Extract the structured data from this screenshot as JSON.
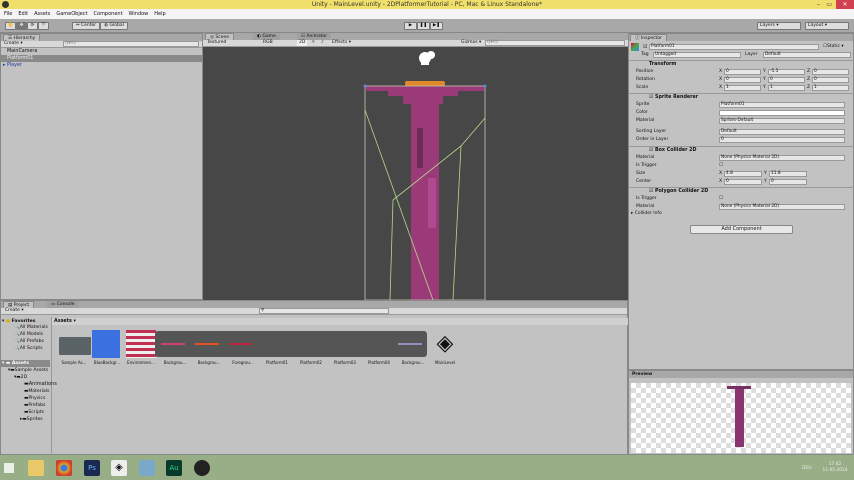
{
  "window": {
    "title": "Unity - MainLevel.unity - 2DPlatformerTutorial - PC, Mac & Linux Standalone*"
  },
  "menu": [
    "File",
    "Edit",
    "Assets",
    "GameObject",
    "Component",
    "Window",
    "Help"
  ],
  "toolbar": {
    "center": "Center",
    "global": "Global",
    "layers": "Layers",
    "layout": "Layout"
  },
  "hierarchy": {
    "tab": "Hierarchy",
    "create": "Create",
    "search": "Q▾All",
    "items": [
      "MainCamera",
      "Platform01",
      "Player"
    ]
  },
  "scene": {
    "tabs": [
      "Scene",
      "Game",
      "Animator"
    ],
    "render_mode": "Textured",
    "color_mode": "RGB",
    "mode_2d": "2D",
    "effects": "Effects",
    "gizmos": "Gizmos",
    "search": "Q▾All"
  },
  "inspector": {
    "tab": "Inspector",
    "object_name": "Platform01",
    "static": "Static",
    "tag_label": "Tag",
    "tag": "Untagged",
    "layer_label": "Layer",
    "layer": "Default",
    "transform": {
      "title": "Transform",
      "rows": [
        {
          "label": "Position",
          "x": "0",
          "y": "-5.5",
          "z": "0"
        },
        {
          "label": "Rotation",
          "x": "0",
          "y": "0",
          "z": "0"
        },
        {
          "label": "Scale",
          "x": "1",
          "y": "1",
          "z": "1"
        }
      ]
    },
    "sprite_renderer": {
      "title": "Sprite Renderer",
      "sprite_label": "Sprite",
      "sprite": "Platform01",
      "color_label": "Color",
      "material_label": "Material",
      "material": "Sprites-Default",
      "sorting_layer_label": "Sorting Layer",
      "sorting_layer": "Default",
      "order_label": "Order in Layer",
      "order": "0"
    },
    "box_collider": {
      "title": "Box Collider 2D",
      "material_label": "Material",
      "material": "None (Physics Material 2D)",
      "trigger_label": "Is Trigger",
      "size_label": "Size",
      "size_x": "4.8",
      "size_y": "11.8",
      "center_label": "Center",
      "center_x": "0",
      "center_y": "0"
    },
    "polygon_collider": {
      "title": "Polygon Collider 2D",
      "trigger_label": "Is Trigger",
      "material_label": "Material",
      "material": "None (Physics Material 2D)",
      "info_label": "Collider Info"
    },
    "add_component": "Add Component",
    "axes": [
      "X",
      "Y",
      "Z"
    ]
  },
  "preview": {
    "title": "Preview"
  },
  "project": {
    "tabs": [
      "Project",
      "Console"
    ],
    "create": "Create",
    "favorites": "Favorites",
    "favorite_items": [
      "All Materials",
      "All Models",
      "All Prefabs",
      "All Scripts"
    ],
    "assets_root": "Assets",
    "tree": [
      "Sample Assets",
      "2D",
      "Animations",
      "Materials",
      "Physics",
      "Prefabs",
      "Scripts",
      "Sprites"
    ],
    "breadcrumb": "Assets",
    "assets": [
      "Sample As...",
      "BlueBackgr...",
      "Environmen...",
      "Backgrou...",
      "Backgrou...",
      "Foregrou...",
      "Platform01",
      "Platform02",
      "Platform03",
      "Platform04",
      "Backgrou...",
      "MainLevel"
    ]
  },
  "taskbar": {
    "lang": "DEU",
    "time": "17:42",
    "date": "11-05-2014"
  }
}
